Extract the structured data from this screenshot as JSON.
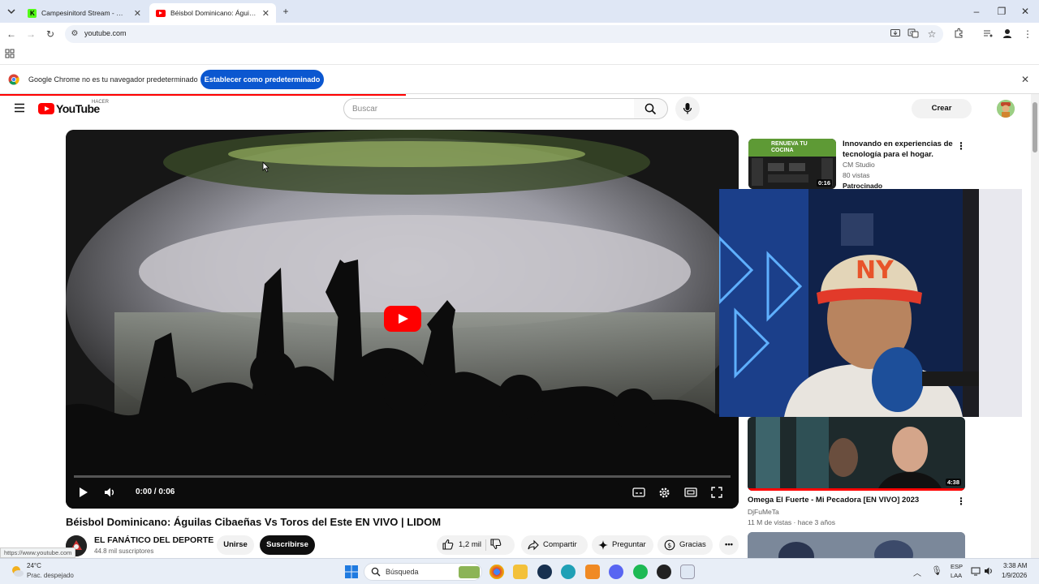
{
  "browser": {
    "tabs": [
      {
        "label": "Campesinitord Stream - Watch",
        "active": false
      },
      {
        "label": "Béisbol Dominicano: Águilas Ci",
        "active": true
      }
    ],
    "address": "youtube.com",
    "infobar": {
      "message": "Google Chrome no es tu navegador predeterminado",
      "button": "Establecer como predeterminado"
    },
    "status_url": "https://www.youtube.com"
  },
  "youtube": {
    "logo_text": "YouTube",
    "logo_badge": "HACER",
    "search_placeholder": "Buscar",
    "create_label": "Crear"
  },
  "video": {
    "time": "0:00 / 0:06",
    "title": "Béisbol Dominicano: Águilas Cibaeñas Vs Toros del Este EN VIVO | LIDOM",
    "channel": "EL FANÁTICO DEL DEPORTE",
    "subscribers": "44.8 mil suscriptores",
    "join_label": "Unirse",
    "subscribe_label": "Suscribirse",
    "likes": "1,2 mil",
    "share_label": "Compartir",
    "ask_label": "Preguntar",
    "thanks_label": "Gracias"
  },
  "sidebar": {
    "ad": {
      "title": "Innovando en experiencias de tecnología para el hogar.",
      "channel": "CM Studio",
      "views": "80 vistas",
      "sponsored": "Patrocinado",
      "duration": "0:16",
      "thumb_text_1": "RENUEVA TU",
      "thumb_text_2": "COCINA"
    },
    "items": [
      {
        "title": "Omega El Fuerte - Mi Pecadora [EN VIVO] 2023",
        "channel": "DjFuMeTa",
        "meta": "11 M de vistas · hace 3 años",
        "duration": "4:38"
      }
    ]
  },
  "taskbar": {
    "weather_temp": "24°C",
    "weather_desc": "Prac. despejado",
    "search_label": "Búsqueda",
    "lang_1": "ESP",
    "lang_2": "LAA",
    "time": "3:38 AM",
    "date": "1/9/2026"
  }
}
